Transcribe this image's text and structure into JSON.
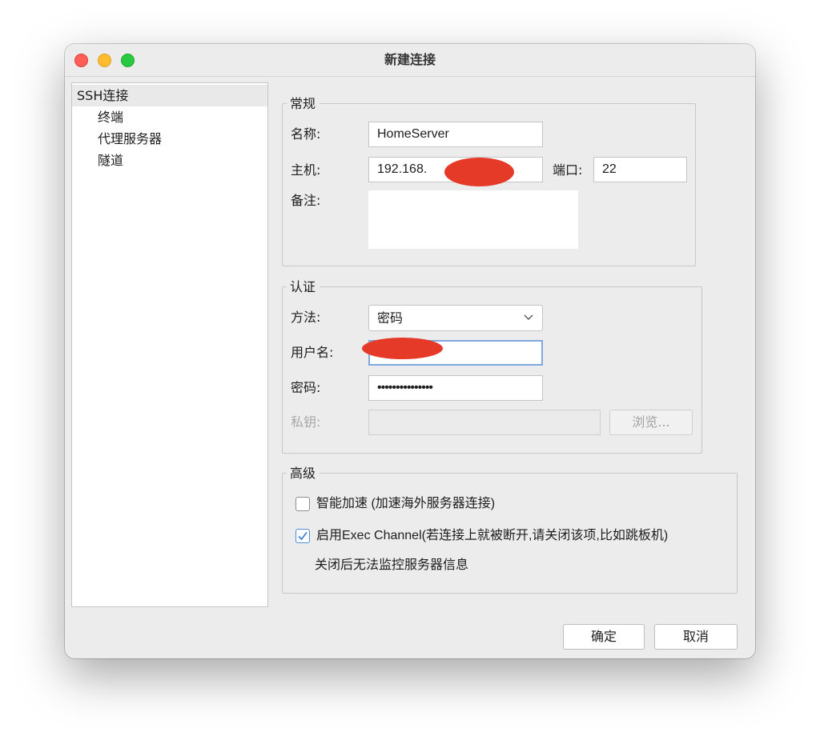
{
  "window": {
    "title": "新建连接"
  },
  "sidebar": {
    "items": [
      {
        "label": "SSH连接"
      },
      {
        "label": "终端"
      },
      {
        "label": "代理服务器"
      },
      {
        "label": "隧道"
      }
    ]
  },
  "general": {
    "title": "常规",
    "name_label": "名称:",
    "name_value": "HomeServer",
    "host_label": "主机:",
    "host_value": "192.168.",
    "port_label": "端口:",
    "port_value": "22",
    "note_label": "备注:"
  },
  "auth": {
    "title": "认证",
    "method_label": "方法:",
    "method_value": "密码",
    "username_label": "用户名:",
    "password_label": "密码:",
    "password_value": "•••••••••••••••",
    "privkey_label": "私钥:",
    "browse_label": "浏览..."
  },
  "advanced": {
    "title": "高级",
    "smart_accel_label": "智能加速 (加速海外服务器连接)",
    "smart_accel_checked": false,
    "exec_channel_label": "启用Exec Channel(若连接上就被断开,请关闭该项,比如跳板机)",
    "exec_channel_checked": true,
    "exec_channel_note": "关闭后无法监控服务器信息"
  },
  "footer": {
    "ok_label": "确定",
    "cancel_label": "取消"
  },
  "colors": {
    "accent": "#4a8fe0",
    "redaction": "#e53a28"
  }
}
